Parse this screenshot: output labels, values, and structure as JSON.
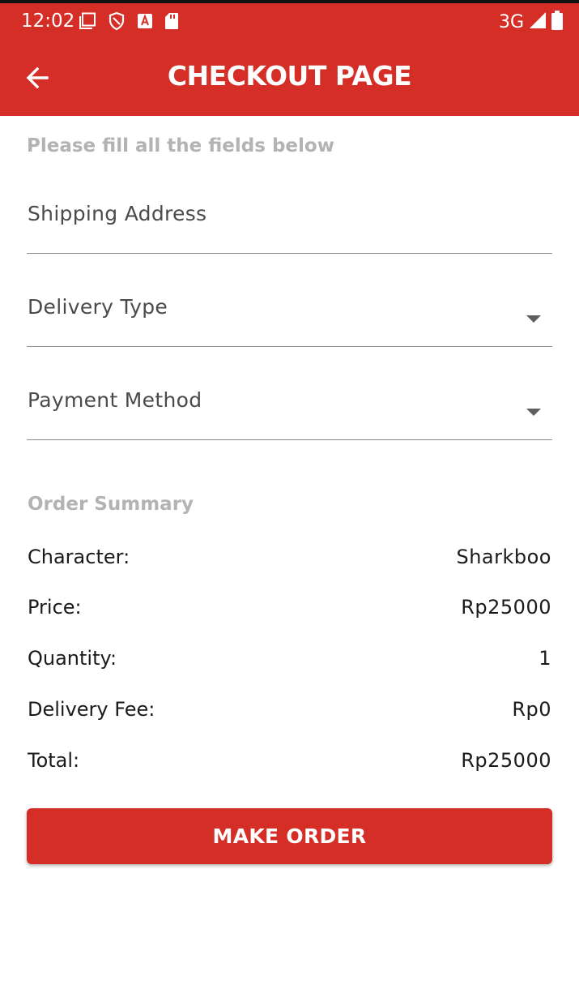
{
  "status_bar": {
    "time": "12:02",
    "network": "3G",
    "icons_left": [
      "screenshot-icon",
      "shield-icon",
      "font-a-icon",
      "sd-card-icon"
    ],
    "icons_right": [
      "signal-icon",
      "battery-icon"
    ]
  },
  "app_bar": {
    "title": "CHECKOUT PAGE",
    "back_icon": "arrow-back-icon"
  },
  "form": {
    "instruction": "Please fill all the fields below",
    "shipping_address": {
      "label": "Shipping Address",
      "value": ""
    },
    "delivery_type": {
      "label": "Delivery Type",
      "selected": ""
    },
    "payment_method": {
      "label": "Payment Method",
      "selected": ""
    }
  },
  "summary": {
    "title": "Order Summary",
    "rows": [
      {
        "label": "Character:",
        "value": "Sharkboo"
      },
      {
        "label": "Price:",
        "value": "Rp25000"
      },
      {
        "label": "Quantity:",
        "value": "1"
      },
      {
        "label": "Delivery Fee:",
        "value": "Rp0"
      },
      {
        "label": "Total:",
        "value": "Rp25000"
      }
    ]
  },
  "actions": {
    "make_order_label": "MAKE ORDER"
  },
  "colors": {
    "primary": "#d42e27",
    "hint_text": "#b3b3b3",
    "body_text": "#1a1a1a"
  }
}
